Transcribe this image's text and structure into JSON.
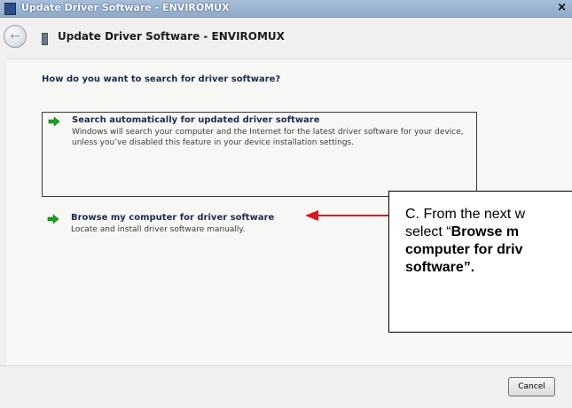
{
  "window": {
    "title": "Update Driver Software - ENVIROMUX",
    "close_glyph": "×"
  },
  "header": {
    "title": "Update Driver Software - ENVIROMUX"
  },
  "main": {
    "question": "How do you want to search for driver software?",
    "options": [
      {
        "title": "Search automatically for updated driver software",
        "description": "Windows will search your computer and the Internet for the latest driver software for your device, unless you’ve disabled this feature in your device installation settings."
      },
      {
        "title": "Browse my computer for driver software",
        "description": "Locate and install driver software manually."
      }
    ]
  },
  "footer": {
    "cancel_label": "Cancel"
  },
  "annotation": {
    "line1": "C. From the next w",
    "line2_prefix": "select “",
    "line2_bold": "Browse m",
    "line3_bold": "computer for driv",
    "line4_bold": "software”."
  },
  "colors": {
    "accent_arrow": "#1e9e2a",
    "annotation_arrow": "#e0141b"
  }
}
